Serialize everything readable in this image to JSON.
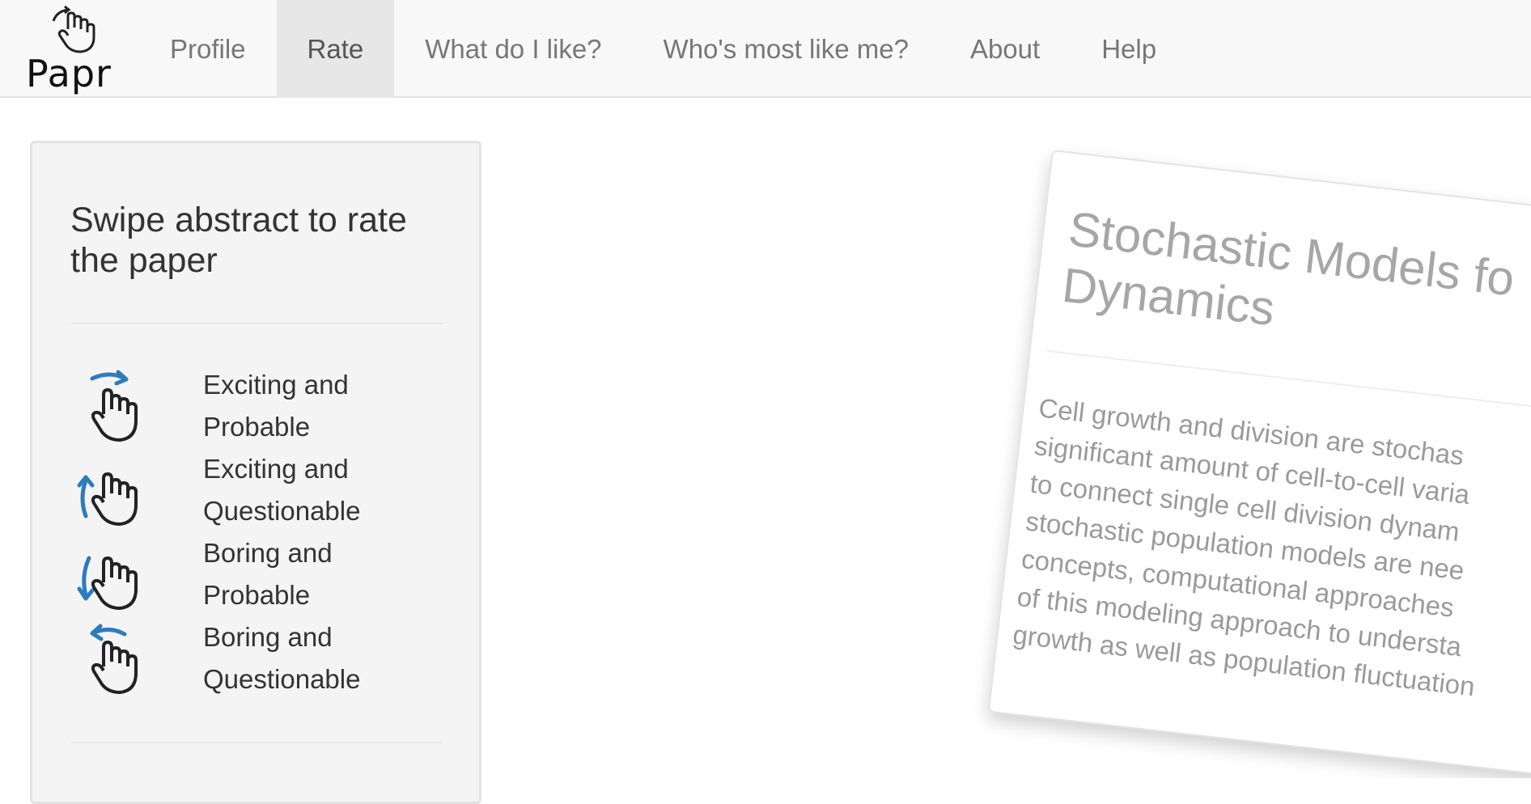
{
  "brand": {
    "name": "Papr",
    "icon": "hand-swipe-logo-icon"
  },
  "nav": {
    "items": [
      {
        "label": "Profile",
        "active": false
      },
      {
        "label": "Rate",
        "active": true
      },
      {
        "label": "What do I like?",
        "active": false
      },
      {
        "label": "Who's most like me?",
        "active": false
      },
      {
        "label": "About",
        "active": false
      },
      {
        "label": "Help",
        "active": false
      }
    ]
  },
  "side_panel": {
    "title": "Swipe abstract to rate the paper",
    "legend": [
      {
        "label": "Exciting and Probable",
        "gesture": "swipe-right-icon"
      },
      {
        "label": "Exciting and Questionable",
        "gesture": "swipe-up-icon"
      },
      {
        "label": "Boring and Probable",
        "gesture": "swipe-down-icon"
      },
      {
        "label": "Boring and Questionable",
        "gesture": "swipe-left-icon"
      }
    ]
  },
  "paper_card": {
    "title": "Stochastic Models fo\nDynamics",
    "abstract": "Cell growth and division are stochas\nsignificant amount of cell-to-cell varia\nto connect single cell division dynam\nstochastic population models are nee\nconcepts, computational approaches\nof this modeling approach to understa\ngrowth as well as population fluctuation"
  },
  "colors": {
    "accent_arrow": "#2b7bbf",
    "navbar_bg": "#f8f8f8",
    "active_tab_bg": "#e7e7e7",
    "panel_bg": "#f4f4f4",
    "card_text": "#9a9a9a"
  }
}
